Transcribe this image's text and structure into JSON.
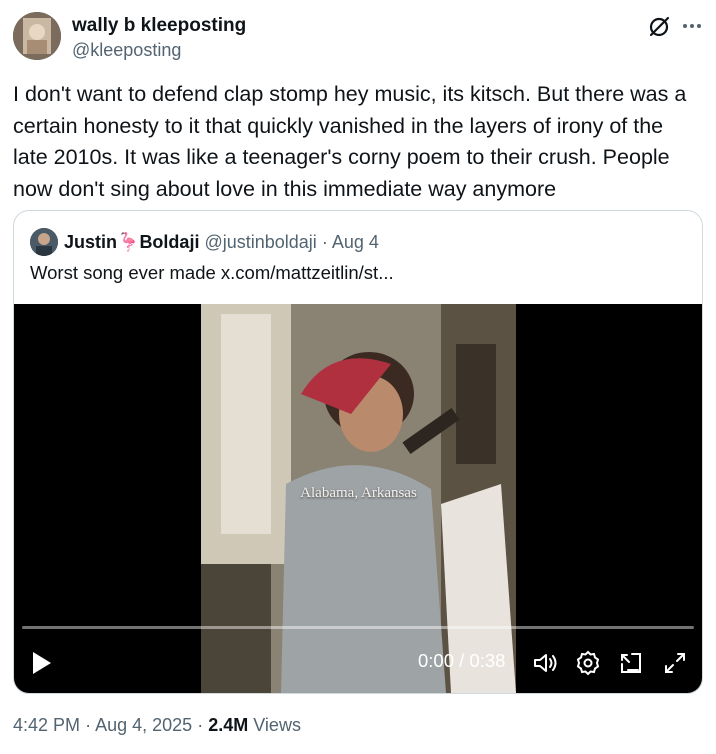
{
  "author": {
    "display_name": "wally b kleeposting",
    "handle": "@kleeposting",
    "avatar_icon": "profile-avatar"
  },
  "header_icons": [
    "grok-icon",
    "more-icon"
  ],
  "tweet": {
    "text": "I don't want to defend clap stomp hey music, its kitsch. But there was a\ncertain honesty to it that quickly vanished in the layers of irony of the\nlate 2010s. It was like a teenager's corny poem to their crush. People\nnow don't sing about love in this immediate way anymore"
  },
  "quoted": {
    "name_first": "Justin",
    "name_emoji": "🦩",
    "name_last": "Boldaji",
    "handle": "@justinboldaji",
    "separator": "·",
    "date": "Aug 4",
    "text": "Worst song ever made  x.com/mattzeitlin/st...",
    "video": {
      "caption": "Alabama, Arkansas",
      "time": "0:00 / 0:38",
      "progress": 0.0,
      "controls": [
        "play-icon",
        "volume-icon",
        "settings-icon",
        "pip-icon",
        "fullscreen-icon"
      ]
    }
  },
  "footer": {
    "time": "4:42 PM",
    "sep1": "·",
    "date": "Aug 4, 2025",
    "sep2": "·",
    "views_count": "2.4M",
    "views_label": "Views"
  },
  "colors": {
    "text": "#0f1419",
    "secondary": "#536471",
    "border": "#cfd9de",
    "video_bg": "#000000"
  }
}
